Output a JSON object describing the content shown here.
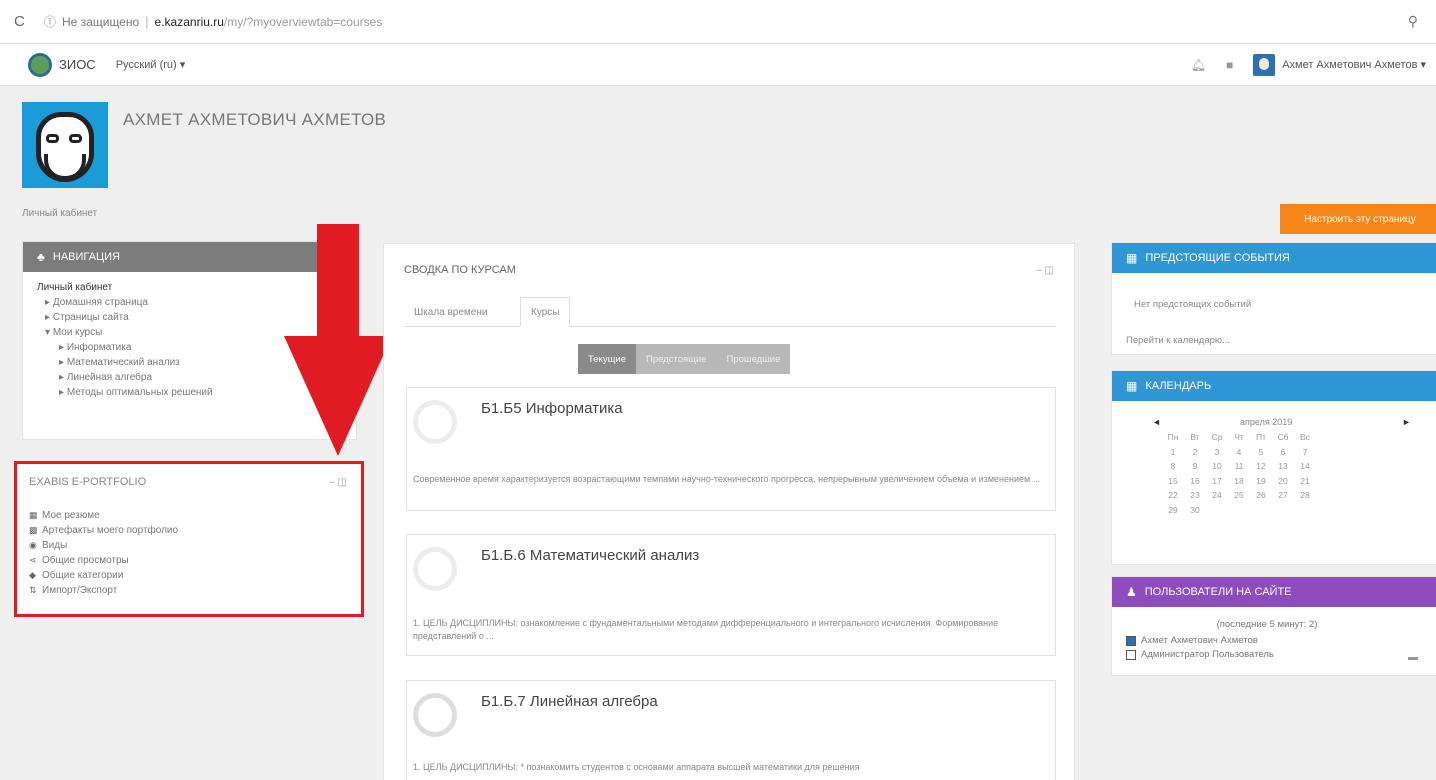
{
  "browser": {
    "security_label": "Не защищено",
    "domain": "e.kazanriu.ru",
    "path": "/my/?myoverviewtab=courses"
  },
  "navbar": {
    "site_name": "ЗИОС",
    "language": "Русский (ru) ▾",
    "user_name": "Ахмет Ахметович Ахметов ▾"
  },
  "header": {
    "full_name": "АХМЕТ АХМЕТОВИЧ АХМЕТОВ",
    "breadcrumb": "Личный кабинет",
    "customize_button": "Настроить эту страницу"
  },
  "navigation": {
    "title": "НАВИГАЦИЯ",
    "root": "Личный кабинет",
    "items": [
      {
        "label": "Домашняя страница",
        "level": 1,
        "marker": "▸"
      },
      {
        "label": "Страницы сайта",
        "level": 1,
        "marker": "▸"
      },
      {
        "label": "Мои курсы",
        "level": 1,
        "marker": "▾"
      },
      {
        "label": "Информатика",
        "level": 2,
        "marker": "▸"
      },
      {
        "label": "Математический анализ",
        "level": 2,
        "marker": "▸"
      },
      {
        "label": "Линейная алгебра",
        "level": 2,
        "marker": "▸"
      },
      {
        "label": "Методы оптимальных решений",
        "level": 2,
        "marker": "▸"
      }
    ]
  },
  "eportfolio": {
    "title": "EXABIS E-PORTFOLIO",
    "items": [
      {
        "label": "Мое резюме",
        "icon": "resume-icon"
      },
      {
        "label": "Артефакты моего портфолио",
        "icon": "artifacts-icon"
      },
      {
        "label": "Виды",
        "icon": "views-icon"
      },
      {
        "label": "Общие просмотры",
        "icon": "share-icon"
      },
      {
        "label": "Общие категории",
        "icon": "tag-icon"
      },
      {
        "label": "Импорт/Экспорт",
        "icon": "import-export-icon"
      }
    ]
  },
  "courses": {
    "title": "СВОДКА ПО КУРСАМ",
    "tabs": [
      "Шкала времени",
      "Курсы"
    ],
    "active_tab": "Курсы",
    "segments": [
      "Текущие",
      "Предстоящие",
      "Прошедшие"
    ],
    "active_segment": "Текущие",
    "list": [
      {
        "name": "Б1.Б5 Информатика",
        "desc": "Современное время характеризуется возрастающими темпами научно-технического прогресса, непрерывным увеличением объема и изменением ..."
      },
      {
        "name": "Б1.Б.6 Математический анализ",
        "desc": "1. ЦЕЛЬ ДИСЦИПЛИНЫ: ознакомление с фундаментальными методами дифференциального и интегрального исчисления. Формирование представлений о ..."
      },
      {
        "name": "Б1.Б.7 Линейная алгебра",
        "desc": "1. ЦЕЛЬ ДИСЦИПЛИНЫ: * познакомить студентов с основами аппарата высшей математики для решения"
      }
    ]
  },
  "events": {
    "title": "ПРЕДСТОЯЩИЕ СОБЫТИЯ",
    "empty": "Нет предстоящих событий",
    "link": "Перейти к календарю..."
  },
  "calendar": {
    "title": "КАЛЕНДАРЬ",
    "prev": "◄",
    "next": "►",
    "month": "апреля 2019",
    "weekdays": [
      "Пн",
      "Вт",
      "Ср",
      "Чт",
      "Пт",
      "Сб",
      "Вс"
    ],
    "days": [
      "1",
      "2",
      "3",
      "4",
      "5",
      "6",
      "7",
      "8",
      "9",
      "10",
      "11",
      "12",
      "13",
      "14",
      "15",
      "16",
      "17",
      "18",
      "19",
      "20",
      "21",
      "22",
      "23",
      "24",
      "25",
      "26",
      "27",
      "28",
      "29",
      "30"
    ]
  },
  "online_users": {
    "title": "ПОЛЬЗОВАТЕЛИ НА САЙТЕ",
    "period": "(последние 5 минут: 2)",
    "users": [
      "Ахмет Ахметович Ахметов",
      "Администратор Пользователь"
    ]
  },
  "colors": {
    "nav_header": "#7c7c7c",
    "blue_header": "#2f97d6",
    "purple_header": "#8f4cbf",
    "customize_button": "#f7861a",
    "highlight_red": "#e01b24"
  }
}
